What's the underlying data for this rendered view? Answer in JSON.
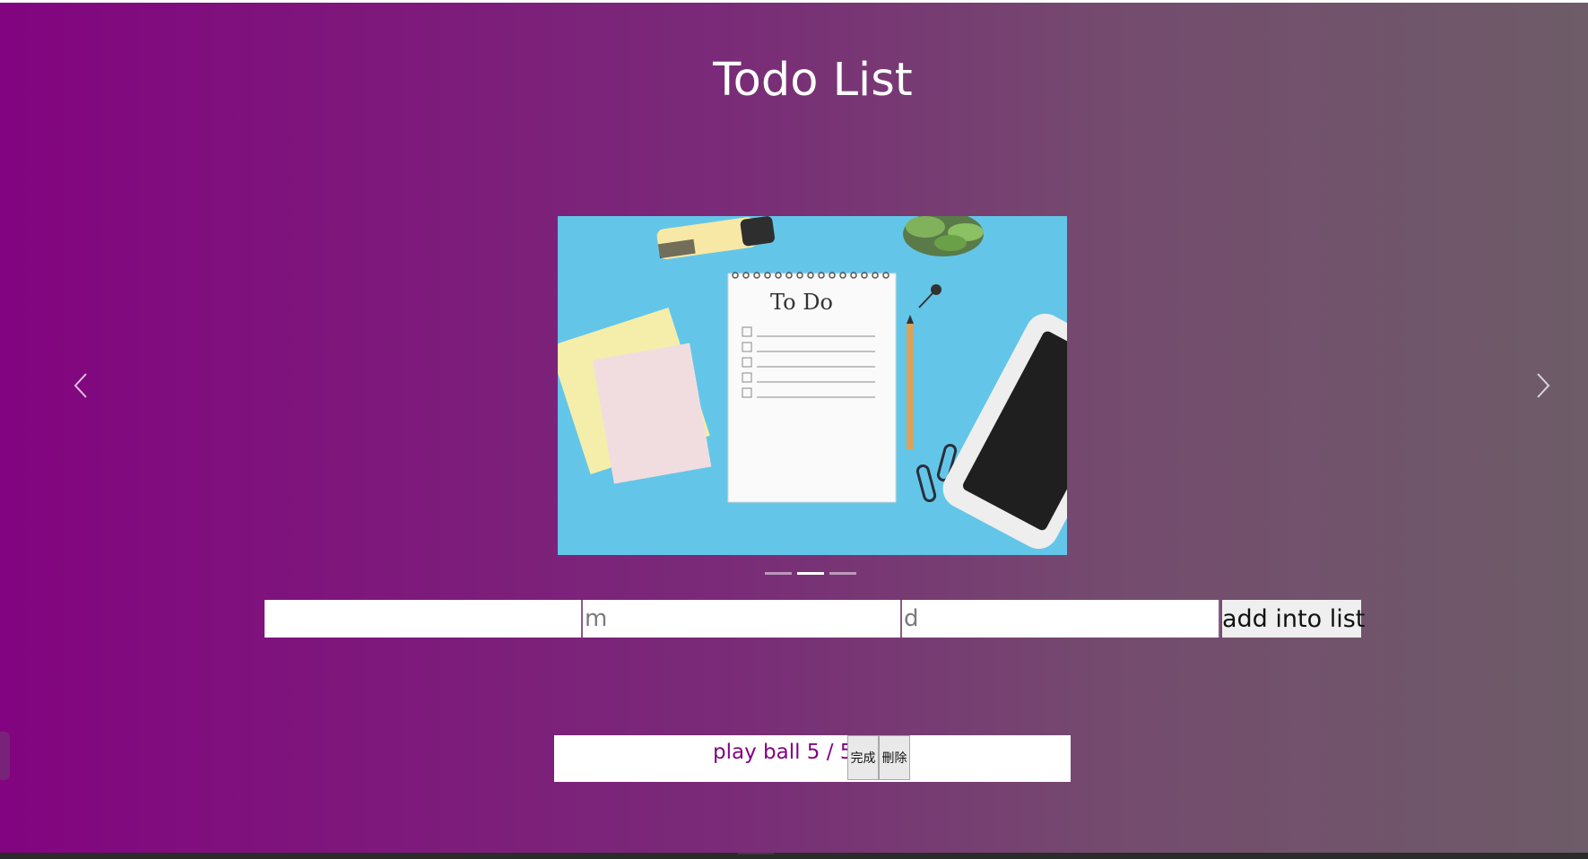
{
  "page": {
    "title": "Todo List"
  },
  "carousel": {
    "slide_text": "To Do",
    "indicator_count": 3,
    "active_index": 1,
    "prev_icon": "chevron-left-icon",
    "next_icon": "chevron-right-icon"
  },
  "form": {
    "title_placeholder": "",
    "month_placeholder": "m",
    "day_placeholder": "d",
    "add_button_label": "add into list"
  },
  "todos": [
    {
      "text": "play ball 5 / 5",
      "done_label": "完成",
      "delete_label": "刪除"
    }
  ],
  "colors": {
    "gradient_start": "#820480",
    "gradient_end": "#6e5c68",
    "todo_text": "#820480"
  }
}
